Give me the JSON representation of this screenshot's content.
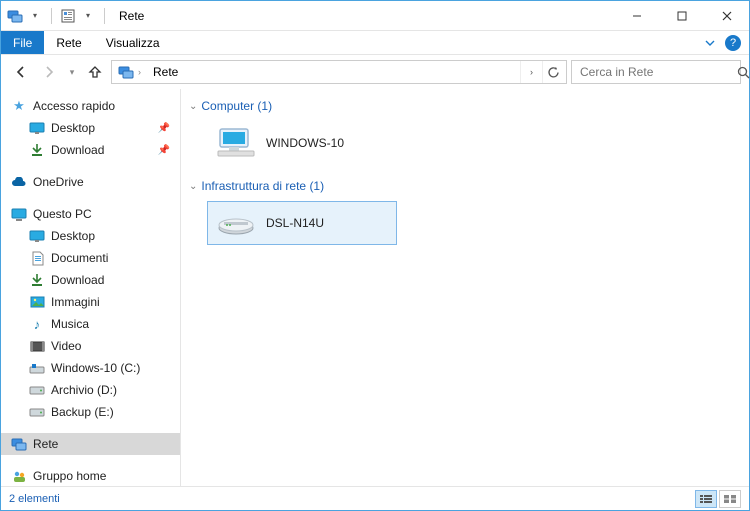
{
  "window": {
    "title": "Rete"
  },
  "ribbon": {
    "file": "File",
    "tabs": [
      "Rete",
      "Visualizza"
    ]
  },
  "address": {
    "location": "Rete"
  },
  "search": {
    "placeholder": "Cerca in Rete"
  },
  "sidebar": {
    "quick_access": "Accesso rapido",
    "quick": [
      {
        "label": "Desktop"
      },
      {
        "label": "Download"
      }
    ],
    "onedrive": "OneDrive",
    "this_pc": "Questo PC",
    "pc": [
      {
        "label": "Desktop"
      },
      {
        "label": "Documenti"
      },
      {
        "label": "Download"
      },
      {
        "label": "Immagini"
      },
      {
        "label": "Musica"
      },
      {
        "label": "Video"
      },
      {
        "label": "Windows-10 (C:)"
      },
      {
        "label": "Archivio (D:)"
      },
      {
        "label": "Backup (E:)"
      }
    ],
    "network": "Rete",
    "homegroup": "Gruppo home"
  },
  "content": {
    "groups": [
      {
        "header": "Computer (1)",
        "items": [
          {
            "label": "WINDOWS-10",
            "kind": "computer",
            "selected": false
          }
        ]
      },
      {
        "header": "Infrastruttura di rete (1)",
        "items": [
          {
            "label": "DSL-N14U",
            "kind": "router",
            "selected": true
          }
        ]
      }
    ]
  },
  "status": {
    "text": "2 elementi"
  }
}
